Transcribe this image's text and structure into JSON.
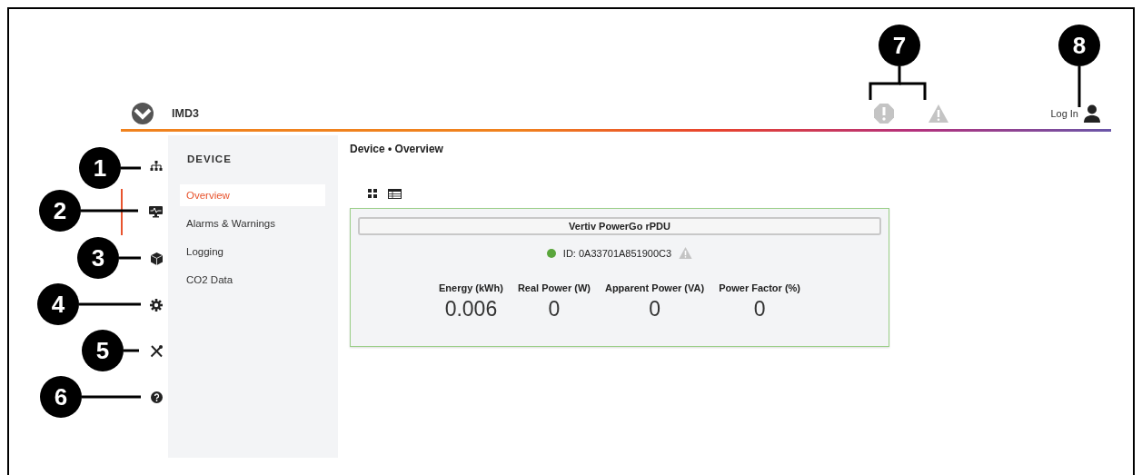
{
  "header": {
    "product": "IMD3",
    "alarm_icons": [
      {
        "kind": "alarm"
      },
      {
        "kind": "warning"
      }
    ],
    "login": "Log In"
  },
  "rail": [
    {
      "kind": "network",
      "selected": false
    },
    {
      "kind": "monitor",
      "selected": true
    },
    {
      "kind": "cube",
      "selected": false
    },
    {
      "kind": "gear",
      "selected": false
    },
    {
      "kind": "tools",
      "selected": false
    },
    {
      "kind": "help",
      "selected": false
    }
  ],
  "submenu": {
    "heading": "DEVICE",
    "items": [
      {
        "label": "Overview",
        "selected": true
      },
      {
        "label": "Alarms & Warnings",
        "selected": false
      },
      {
        "label": "Logging",
        "selected": false
      },
      {
        "label": "CO2 Data",
        "selected": false
      }
    ]
  },
  "main": {
    "breadcrumb": "Device • Overview",
    "view_toggles": [
      {
        "kind": "grid"
      },
      {
        "kind": "table"
      }
    ],
    "card": {
      "title": "Vertiv PowerGo rPDU",
      "color": "#5aa63c",
      "id": "ID: 0A33701A851900C3",
      "warning": true,
      "metrics": [
        {
          "label": "Energy (kWh)",
          "value": "0.006"
        },
        {
          "label": "Real Power (W)",
          "value": "0"
        },
        {
          "label": "Apparent Power (VA)",
          "value": "0"
        },
        {
          "label": "Power Factor (%)",
          "value": "0"
        }
      ]
    }
  },
  "callouts": [
    "1",
    "2",
    "3",
    "4",
    "5",
    "6",
    "7",
    "8"
  ]
}
